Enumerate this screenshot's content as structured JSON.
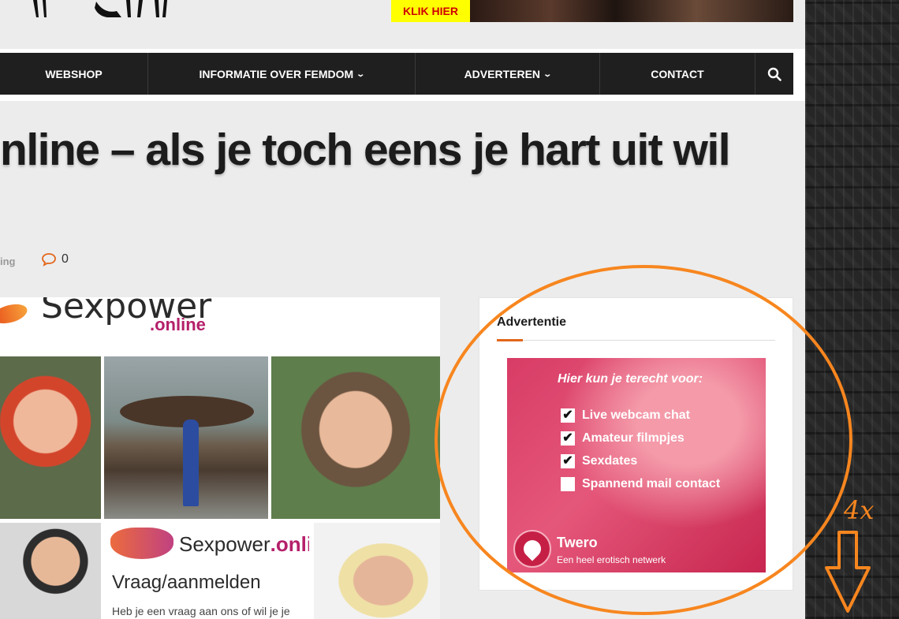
{
  "header": {
    "klik_label": "KLIK HIER"
  },
  "nav": {
    "items": [
      {
        "label": "WEBSHOP",
        "has_dropdown": false
      },
      {
        "label": "INFORMATIE OVER FEMDOM",
        "has_dropdown": true
      },
      {
        "label": "ADVERTEREN",
        "has_dropdown": true
      },
      {
        "label": "CONTACT",
        "has_dropdown": false
      }
    ],
    "search_icon": "search-icon"
  },
  "article": {
    "title": "nline – als je toch eens je hart uit wil",
    "category_fragment": "ing",
    "comment_count": "0"
  },
  "featured": {
    "brand_name": "Sexpower",
    "brand_online": ".online",
    "panel_brand": "Sexpower",
    "panel_brand_suffix": ".online",
    "panel_subtitle": "Vraag/aanmelden",
    "panel_text": "Heb je een vraag aan ons of wil je je"
  },
  "sidebar": {
    "widget_title": "Advertentie",
    "ad": {
      "heading": "Hier kun je terecht voor:",
      "items": [
        {
          "label": "Live webcam chat",
          "checked": true
        },
        {
          "label": "Amateur filmpjes",
          "checked": true
        },
        {
          "label": "Sexdates",
          "checked": true
        },
        {
          "label": "Spannend mail contact",
          "checked": false
        }
      ],
      "brand": "Twero",
      "tagline": "Een heel erotisch netwerk"
    }
  },
  "annotation": {
    "text": "4x",
    "color": "#f7861f"
  },
  "colors": {
    "nav_bg": "#1f1f1f",
    "accent": "#e2661b",
    "ad_pink": "#d83c66",
    "klik_bg": "#ffff00",
    "klik_text": "#d00000"
  }
}
